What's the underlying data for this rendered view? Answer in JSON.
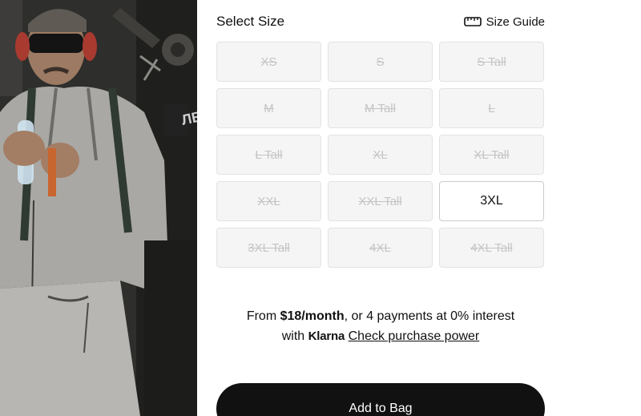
{
  "size_selector": {
    "title": "Select Size",
    "guide_label": "Size Guide",
    "guide_icon": "ruler-icon",
    "sizes": [
      {
        "label": "XS",
        "available": false
      },
      {
        "label": "S",
        "available": false
      },
      {
        "label": "S Tall",
        "available": false
      },
      {
        "label": "M",
        "available": false
      },
      {
        "label": "M Tall",
        "available": false
      },
      {
        "label": "L",
        "available": false
      },
      {
        "label": "L Tall",
        "available": false
      },
      {
        "label": "XL",
        "available": false
      },
      {
        "label": "XL Tall",
        "available": false
      },
      {
        "label": "XXL",
        "available": false
      },
      {
        "label": "XXL Tall",
        "available": false
      },
      {
        "label": "3XL",
        "available": true
      },
      {
        "label": "3XL Tall",
        "available": false
      },
      {
        "label": "4XL",
        "available": false
      },
      {
        "label": "4XL Tall",
        "available": false
      }
    ]
  },
  "financing": {
    "prefix": "From ",
    "amount": "$18/month",
    "suffix": ", or 4 payments at 0% interest",
    "with": "with ",
    "provider": "Klarna",
    "link_label": "Check purchase power"
  },
  "cta": {
    "add_to_bag_label": "Add to Bag"
  },
  "colors": {
    "primary": "#111111",
    "unavailable_bg": "#f5f5f5",
    "unavailable_text": "#c4c4c4"
  }
}
